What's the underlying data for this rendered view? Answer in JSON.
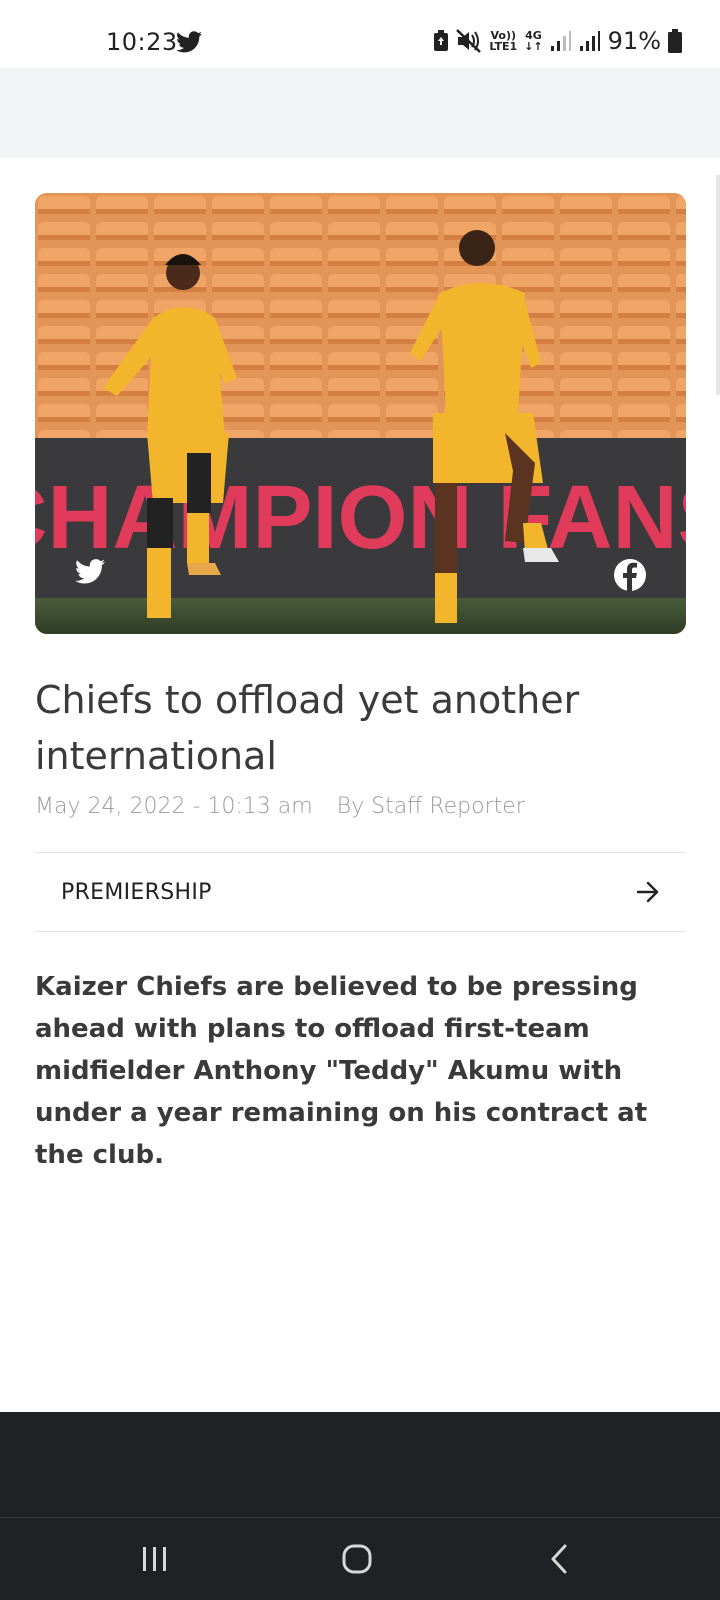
{
  "status_bar": {
    "time": "10:23",
    "battery_percent": "91%",
    "network_type": "4G",
    "volte_line1": "Vo))",
    "volte_line2": "LTE1"
  },
  "article": {
    "hero_banner_text": "CHAMPION FANS",
    "title": "Chiefs to offload yet another international",
    "date": "May 24, 2022 - 10:13 am",
    "author": "By Staff Reporter",
    "category": "PREMIERSHIP",
    "lead": "Kaizer Chiefs are believed to be pressing ahead with plans to offload first-team midfielder Anthony \"Teddy\" Akumu with under a year remaining on his contract at the club."
  },
  "colors": {
    "accent_dark": "#202124",
    "strip_grey": "#f2f3f5",
    "kit_gold": "#f3b52b"
  },
  "icons": {
    "status": [
      "twitter-icon",
      "battery-saver-icon",
      "mute-icon",
      "signal-icon",
      "battery-icon"
    ],
    "hero": [
      "twitter-share-icon",
      "facebook-share-icon"
    ],
    "category": "arrow-right-icon",
    "nav": [
      "recents-icon",
      "home-icon",
      "back-icon"
    ]
  }
}
